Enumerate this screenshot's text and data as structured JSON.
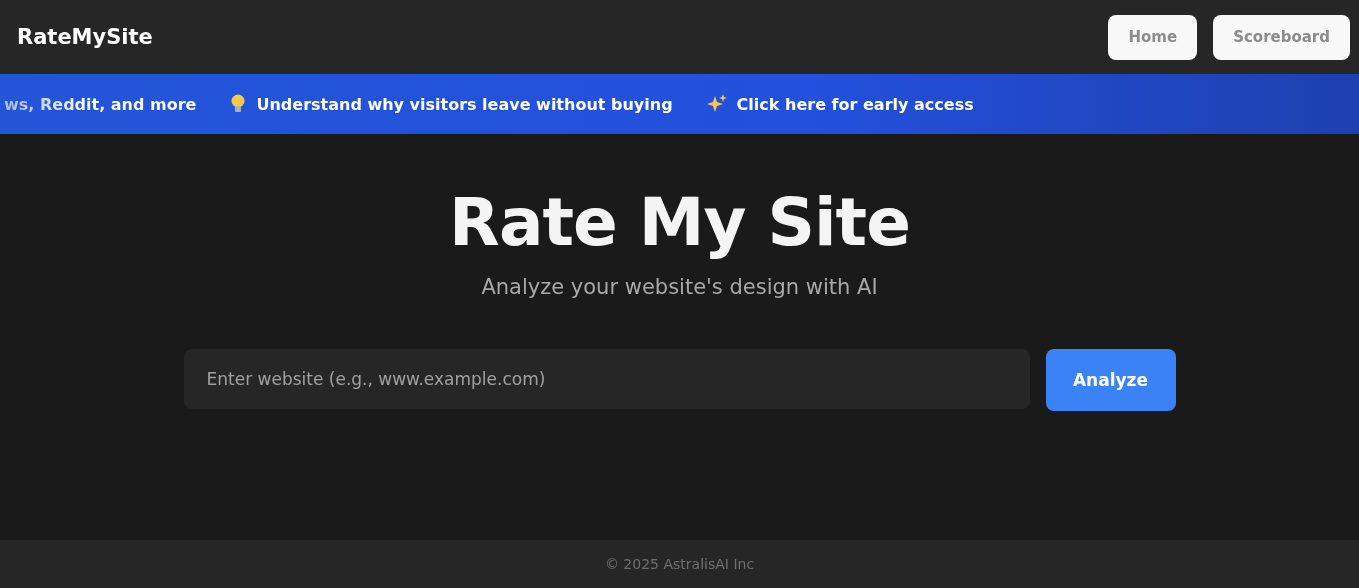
{
  "header": {
    "logo": "RateMySite",
    "nav": [
      {
        "label": "Home"
      },
      {
        "label": "Scoreboard"
      }
    ]
  },
  "ticker": [
    {
      "kind": "plain",
      "text": "ws, Reddit, and more"
    },
    {
      "kind": "tip",
      "text": "Understand why visitors leave without buying"
    },
    {
      "kind": "promo",
      "text": "Click here for early access"
    }
  ],
  "hero": {
    "title": "Rate My Site",
    "subtitle": "Analyze your website's design with AI",
    "search": {
      "placeholder": "Enter website (e.g., www.example.com)"
    },
    "button": "Analyze"
  },
  "footer": "© 2025 AstralisAI Inc"
}
